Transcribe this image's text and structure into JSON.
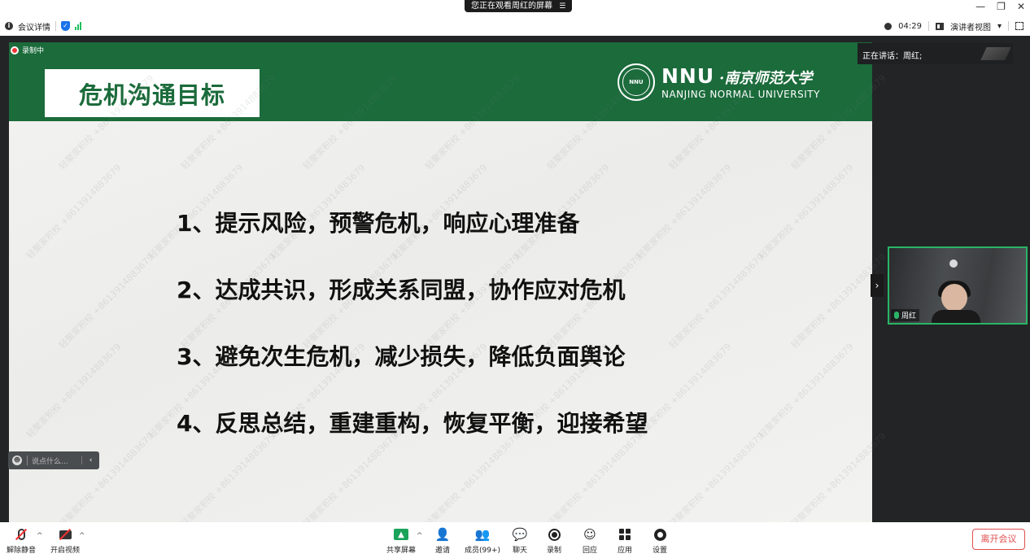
{
  "top_banner": {
    "text": "您正在观看周红的屏幕",
    "menu_icon": "menu-icon"
  },
  "window_controls": {
    "minimize": "—",
    "restore": "❐",
    "close": "✕"
  },
  "info_bar": {
    "meeting_details": "会议详情",
    "timer": "04:29",
    "view_mode": "演讲者视图",
    "dropdown": "▾"
  },
  "recording_badge": "录制中",
  "slide": {
    "title": "危机沟通目标",
    "logo": {
      "abbr": "NNU",
      "name_cn": "·南京师范大学",
      "name_en": "NANJING NORMAL UNIVERSITY",
      "seal_text": "NNU"
    },
    "items": [
      "1、提示风险，预警危机，响应心理准备",
      "2、达成共识，形成关系同盟，协作应对危机",
      "3、避免次生危机，减少损失，降低负面舆论",
      "4、反思总结，重建重构，恢复平衡，迎接希望"
    ],
    "watermark": "轻聚家积校 +8613914883679"
  },
  "chat_input": {
    "placeholder": "说点什么...",
    "collapse": "‹"
  },
  "speaking_indicator": "正在讲话：周红;",
  "collapse_panel": "›",
  "video": {
    "participant_name": "周红"
  },
  "toolbar": {
    "unmute": "解除静音",
    "start_video": "开启视频",
    "share_screen": "共享屏幕",
    "invite": "邀请",
    "members": "成员(99+)",
    "chat": "聊天",
    "record": "录制",
    "reactions": "回应",
    "apps": "应用",
    "settings": "设置",
    "leave": "离开会议",
    "caret": "^"
  },
  "colors": {
    "header_green": "#1b6b3b",
    "active_speaker_border": "#2ab566",
    "leave_red": "#e05050"
  }
}
